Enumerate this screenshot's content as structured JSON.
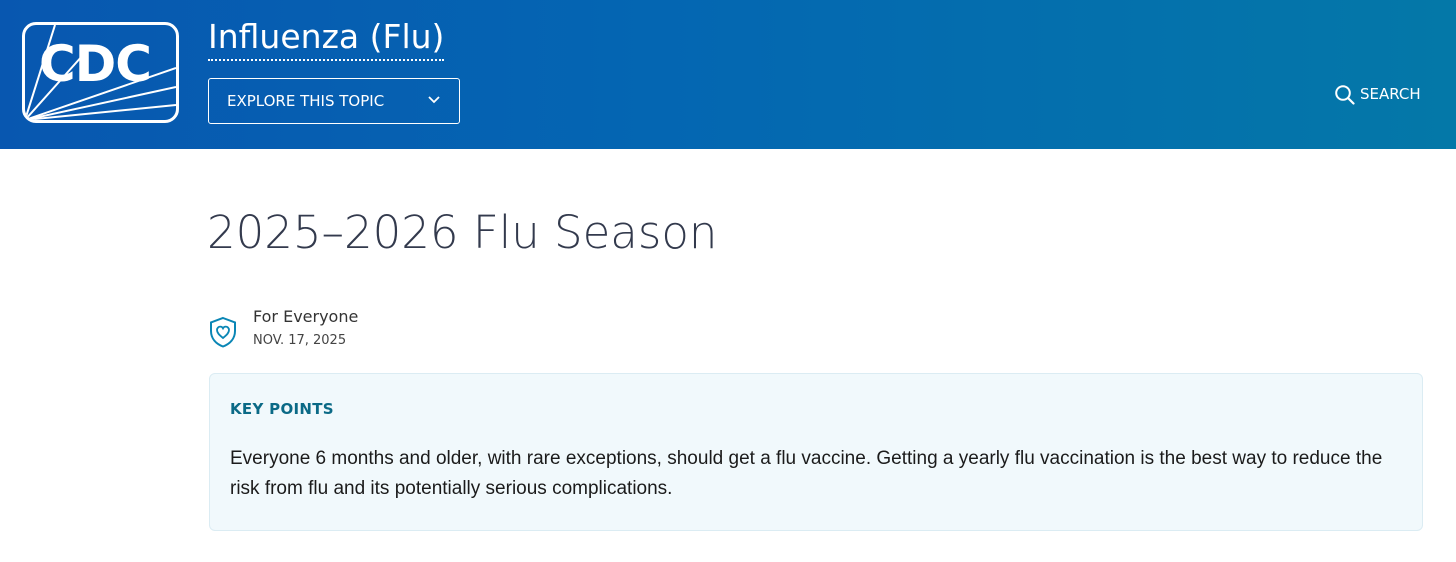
{
  "header": {
    "logo_text": "CDC",
    "site_title": "Influenza (Flu)",
    "explore_button_label": "EXPLORE THIS TOPIC",
    "search_label": "SEARCH",
    "colors": {
      "gradient_start": "#0857b0",
      "gradient_end": "#0478a8"
    }
  },
  "main": {
    "title": "2025–2026 Flu Season",
    "audience": {
      "icon": "heart-shield-icon",
      "label": "For Everyone",
      "date": "NOV. 17, 2025"
    },
    "key_points": {
      "heading": "KEY POINTS",
      "body": "Everyone 6 months and older, with rare exceptions, should get a flu vaccine. Getting a yearly flu vaccination is the best way to reduce the risk from flu and its potentially serious complications.",
      "colors": {
        "background": "#f1f9fc",
        "heading": "#0b6a86"
      }
    }
  }
}
